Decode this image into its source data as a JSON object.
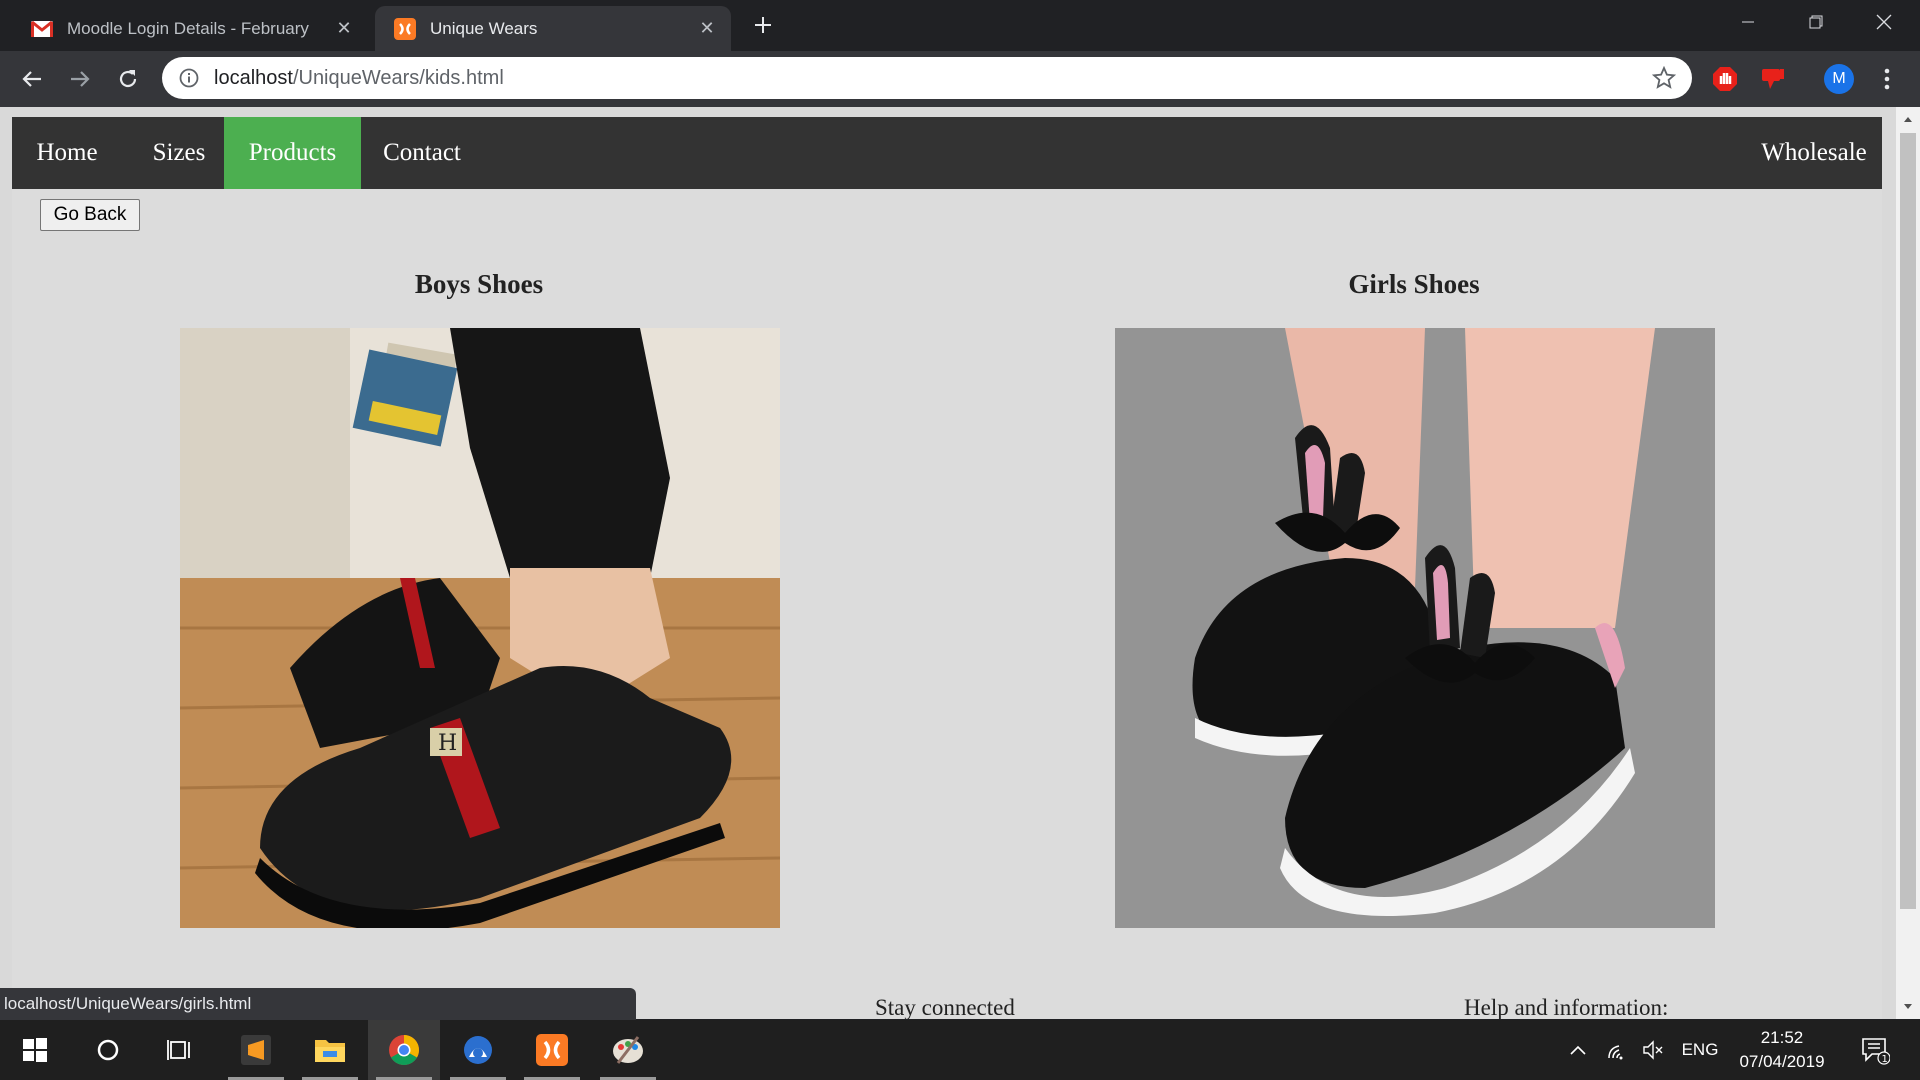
{
  "browser": {
    "tabs": [
      {
        "title": "Moodle Login Details - February",
        "favicon": "gmail-icon",
        "active": false
      },
      {
        "title": "Unique Wears",
        "favicon": "xampp-icon",
        "active": true
      }
    ],
    "url_host": "localhost",
    "url_path": "/UniqueWears/kids.html",
    "profile_initial": "M",
    "status_url": "localhost/UniqueWears/girls.html"
  },
  "site": {
    "nav": {
      "home": "Home",
      "sizes": "Sizes",
      "products": "Products",
      "contact": "Contact",
      "wholesale": "Wholesale"
    },
    "active_nav_color": "#4caf50",
    "go_back": "Go Back",
    "sections": [
      {
        "title": "Boys Shoes",
        "image": "black-loafer-photo"
      },
      {
        "title": "Girls Shoes",
        "image": "bunny-ear-sneaker-photo"
      }
    ],
    "footer": {
      "stay": "Stay connected",
      "help": "Help and information:"
    }
  },
  "taskbar": {
    "lang": "ENG",
    "time": "21:52",
    "date": "07/04/2019",
    "notifications": "1"
  }
}
